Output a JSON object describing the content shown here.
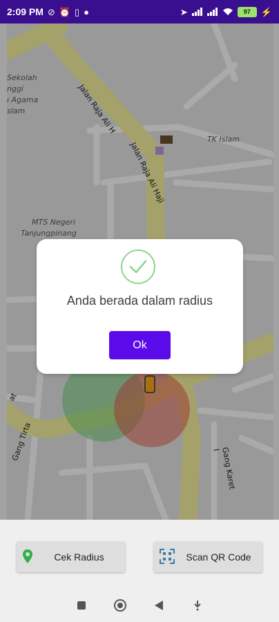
{
  "status_bar": {
    "time": "2:09 PM",
    "battery": "97",
    "icons_left": [
      "do-not-disturb-icon",
      "alarm-icon",
      "sim-icon",
      "no-entry-icon"
    ],
    "icons_right": [
      "location-icon",
      "signal-icon",
      "signal-icon",
      "wifi-icon",
      "battery-icon",
      "charging-icon"
    ]
  },
  "map": {
    "labels": {
      "school_1": "Sekolah",
      "school_2": "nggi",
      "school_3": "ı Agama",
      "school_4": "slam",
      "tk_islam": "TK Islam",
      "mts_1": "MTS Negeri",
      "mts_2": "Tanjungpinang"
    },
    "roads": {
      "raja_ali_1": "Jalan Raja Ali H",
      "raja_ali_2": "Jalan Raja Ali Haji",
      "gang_tirta": "Gang Tirta",
      "gang_karet": "Gang Karet I",
      "partial_at": "at"
    }
  },
  "dialog": {
    "message": "Anda berada dalam radius",
    "ok_label": "Ok",
    "check_color": "#8ed48c"
  },
  "actions": {
    "cek_radius": "Cek Radius",
    "scan_qr": "Scan QR Code"
  },
  "colors": {
    "accent": "#5b0bea",
    "status_bar": "#3a0f8f",
    "road_fill": "#f6f3b9",
    "radius_red": "#e45b4d",
    "radius_green": "#6fcf73"
  }
}
